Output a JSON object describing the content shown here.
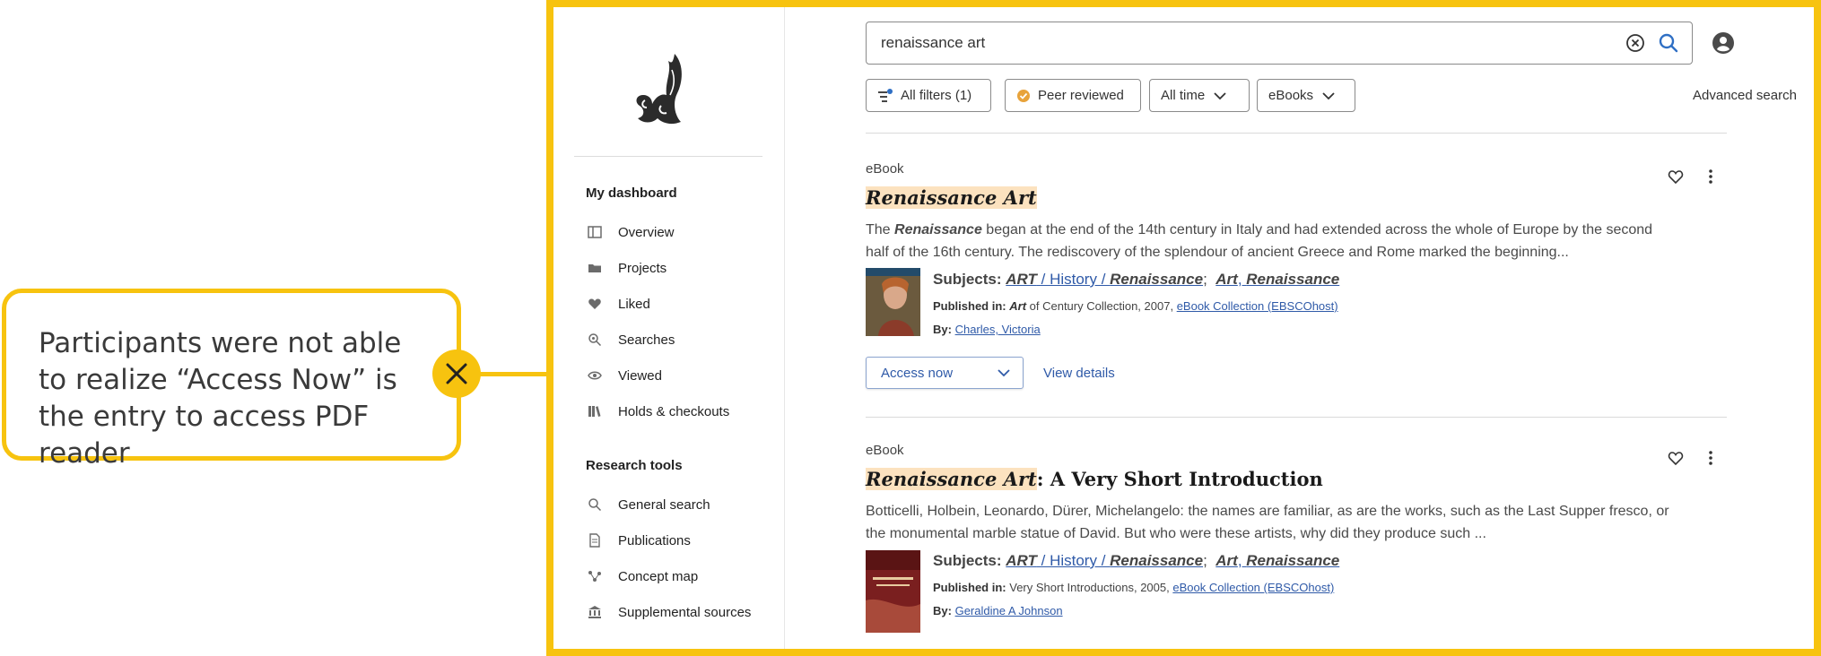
{
  "annotation": {
    "text": "Participants were not able to realize “Access Now” is the entry to access PDF reader",
    "accent": "#f7c30f"
  },
  "sidebar": {
    "dashboard_heading": "My dashboard",
    "dashboard_items": [
      {
        "label": "Overview",
        "icon": "overview-icon"
      },
      {
        "label": "Projects",
        "icon": "folder-icon"
      },
      {
        "label": "Liked",
        "icon": "heart-icon"
      },
      {
        "label": "Searches",
        "icon": "search-history-icon"
      },
      {
        "label": "Viewed",
        "icon": "eye-icon"
      },
      {
        "label": "Holds & checkouts",
        "icon": "books-icon"
      }
    ],
    "tools_heading": "Research tools",
    "tools_items": [
      {
        "label": "General search",
        "icon": "search-icon"
      },
      {
        "label": "Publications",
        "icon": "document-icon"
      },
      {
        "label": "Concept map",
        "icon": "concept-map-icon"
      },
      {
        "label": "Supplemental sources",
        "icon": "institution-icon"
      }
    ]
  },
  "search": {
    "query": "renaissance art"
  },
  "filters": {
    "all_filters": "All filters (1)",
    "peer_reviewed": "Peer reviewed",
    "time": "All time",
    "source_type": "eBooks",
    "advanced": "Advanced search"
  },
  "results": [
    {
      "type": "eBook",
      "title_highlight": "Renaissance Art",
      "title_rest": "",
      "desc_pre": "The ",
      "desc_hl": "Renaissance",
      "desc_post": " began at the end of the 14th century in Italy and had extended across the whole of Europe by the second half of the 16th century. The rediscovery of the splendour of ancient Greece and Rome marked the beginning...",
      "subjects_label": "Subjects:",
      "subject1_a": "ART",
      "subject1_b": " / History / ",
      "subject1_c": "Renaissance",
      "subject2_a": "Art",
      "subject2_b": ", ",
      "subject2_c": "Renaissance",
      "published_label": "Published in:",
      "published_series": "Art",
      "published_rest": " of Century Collection, 2007, ",
      "published_source": "eBook Collection (EBSCOhost)",
      "by_label": "By:",
      "author": "Charles, Victoria"
    },
    {
      "type": "eBook",
      "title_highlight": "Renaissance Art",
      "title_rest": ": A Very Short Introduction",
      "desc": "Botticelli, Holbein, Leonardo, Dürer, Michelangelo: the names are familiar, as are the works, such as the Last Supper fresco, or the monumental marble statue of David. But who were these artists, why did they produce such ...",
      "subjects_label": "Subjects:",
      "subject1_a": "ART",
      "subject1_b": " / History / ",
      "subject1_c": "Renaissance",
      "subject2_a": "Art",
      "subject2_b": ", ",
      "subject2_c": "Renaissance",
      "published_label": "Published in:",
      "published_rest": " Very Short Introductions, 2005, ",
      "published_source": "eBook Collection (EBSCOhost)",
      "by_label": "By:",
      "author": "Geraldine A Johnson"
    }
  ],
  "actions": {
    "access_now": "Access now",
    "view_details": "View details"
  },
  "chat_badge": "×"
}
